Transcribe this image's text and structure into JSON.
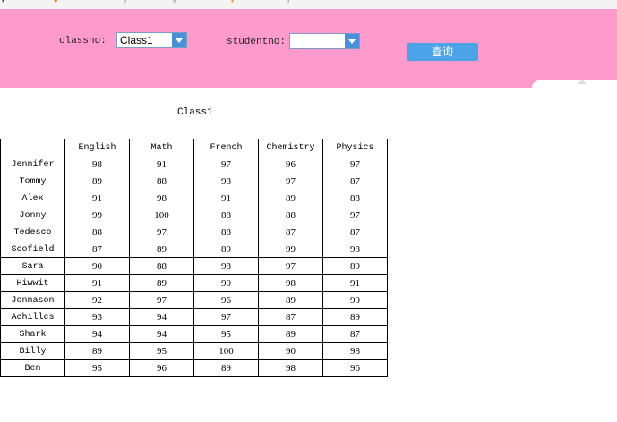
{
  "filters": {
    "classno_label": "classno:",
    "classno_value": "Class1",
    "studentno_label": "studentno:",
    "studentno_value": "",
    "query_label": "查询"
  },
  "table": {
    "caption": "Class1",
    "columns": [
      "",
      "English",
      "Math",
      "French",
      "Chemistry",
      "Physics"
    ],
    "rows": [
      [
        "Jennifer",
        "98",
        "91",
        "97",
        "96",
        "97"
      ],
      [
        "Tommy",
        "89",
        "88",
        "98",
        "97",
        "87"
      ],
      [
        "Alex",
        "91",
        "98",
        "91",
        "89",
        "88"
      ],
      [
        "Jonny",
        "99",
        "100",
        "88",
        "88",
        "97"
      ],
      [
        "Tedesco",
        "88",
        "97",
        "88",
        "87",
        "87"
      ],
      [
        "Scofield",
        "87",
        "89",
        "89",
        "99",
        "98"
      ],
      [
        "Sara",
        "90",
        "88",
        "98",
        "97",
        "89"
      ],
      [
        "Hiwwit",
        "91",
        "89",
        "90",
        "98",
        "91"
      ],
      [
        "Jonnason",
        "92",
        "97",
        "96",
        "89",
        "99"
      ],
      [
        "Achilles",
        "93",
        "94",
        "97",
        "87",
        "89"
      ],
      [
        "Shark",
        "94",
        "94",
        "95",
        "89",
        "87"
      ],
      [
        "Billy",
        "89",
        "95",
        "100",
        "90",
        "98"
      ],
      [
        "Ben",
        "95",
        "96",
        "89",
        "98",
        "96"
      ]
    ]
  }
}
